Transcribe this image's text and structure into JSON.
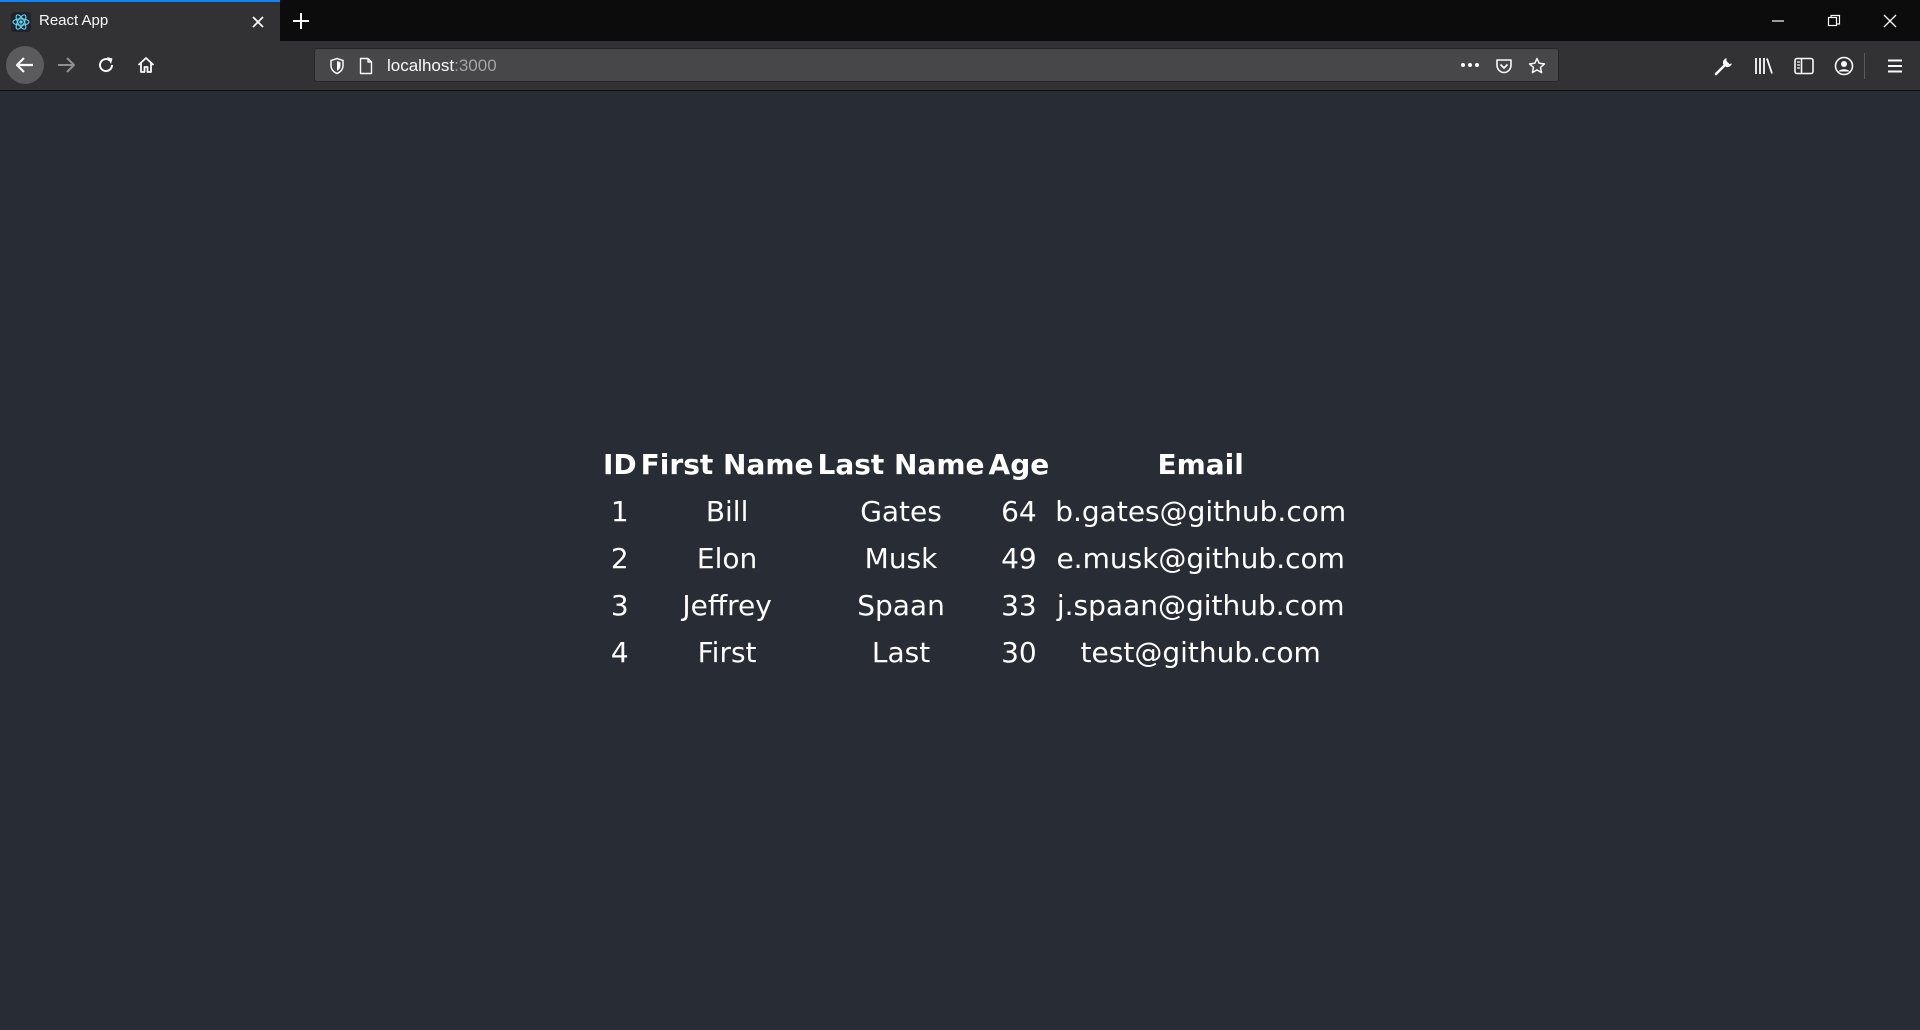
{
  "browser": {
    "tab": {
      "title": "React App"
    },
    "address_bar": {
      "host": "localhost",
      "port": ":3000"
    }
  },
  "table": {
    "headers": [
      "ID",
      "First Name",
      "Last Name",
      "Age",
      "Email"
    ],
    "rows": [
      [
        "1",
        "Bill",
        "Gates",
        "64",
        "b.gates@github.com"
      ],
      [
        "2",
        "Elon",
        "Musk",
        "49",
        "e.musk@github.com"
      ],
      [
        "3",
        "Jeffrey",
        "Spaan",
        "33",
        "j.spaan@github.com"
      ],
      [
        "4",
        "First",
        "Last",
        "30",
        "test@github.com"
      ]
    ]
  },
  "colors": {
    "page_background": "#282c34",
    "tab_accent": "#0a84ff",
    "text": "#ffffff"
  },
  "icons": {
    "favicon": "react-logo-icon",
    "tab_close": "close-icon",
    "new_tab": "plus-icon",
    "minimize": "minimize-icon",
    "restore": "restore-icon",
    "close_window": "close-icon",
    "back": "arrow-left-icon",
    "forward": "arrow-right-icon",
    "reload": "reload-icon",
    "home": "home-icon",
    "tracking": "shield-icon",
    "page_info": "page-icon",
    "page_actions": "more-horizontal-icon",
    "pocket": "pocket-icon",
    "bookmark": "star-icon",
    "tools": "wrench-icon",
    "library": "library-icon",
    "sidebar": "sidebar-icon",
    "account": "account-icon",
    "menu": "hamburger-menu-icon"
  }
}
